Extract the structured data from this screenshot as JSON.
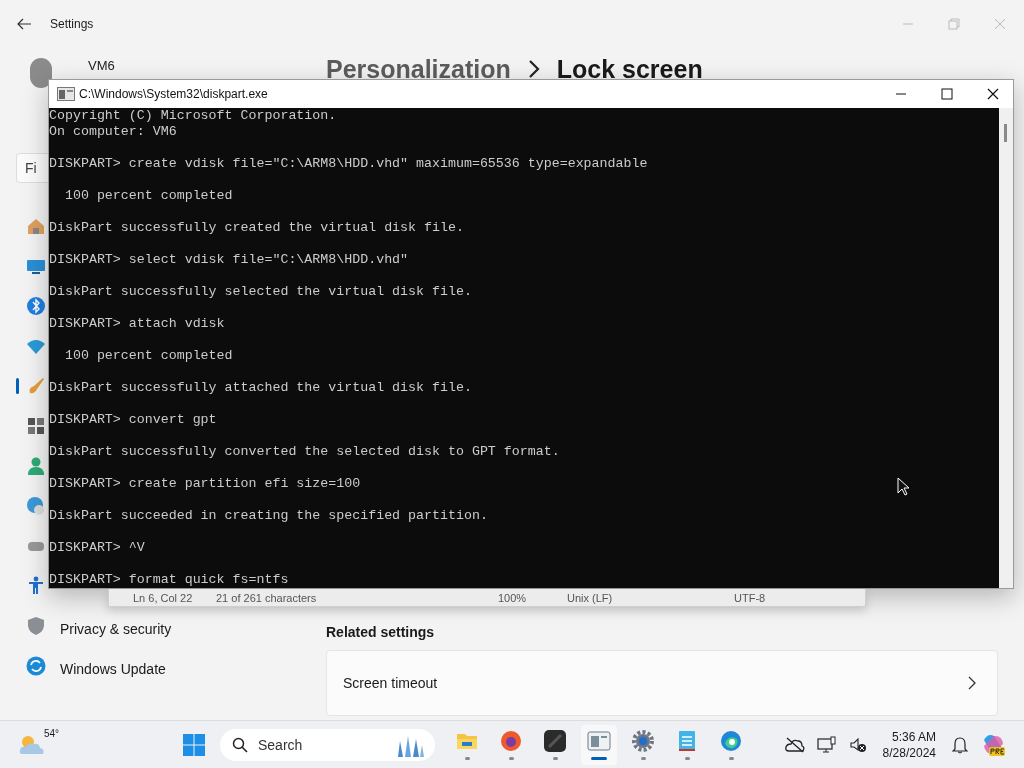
{
  "settings_window": {
    "title": "Settings",
    "profile": {
      "name": "VM6"
    },
    "search": {
      "placeholder": "Fi"
    },
    "sidebar": {
      "items": [
        {
          "selected": false
        },
        {
          "selected": false
        },
        {
          "selected": false
        },
        {
          "selected": false
        },
        {
          "selected": true
        },
        {
          "selected": false
        },
        {
          "selected": false
        },
        {
          "selected": false
        },
        {
          "selected": false
        },
        {
          "selected": false
        },
        {
          "label": "Privacy & security",
          "selected": false
        },
        {
          "label": "Windows Update",
          "selected": false
        }
      ]
    },
    "breadcrumb": [
      "Personalization",
      "Lock screen"
    ],
    "related_settings": {
      "heading": "Related settings",
      "items": [
        {
          "label": "Screen timeout"
        }
      ]
    }
  },
  "console_window": {
    "title": "C:\\Windows\\System32\\diskpart.exe",
    "blocks": [
      [
        "Copyright (C) Microsoft Corporation.",
        "On computer: VM6"
      ],
      [
        "DISKPART> create vdisk file=\"C:\\ARM8\\HDD.vhd\" maximum=65536 type=expandable"
      ],
      [
        "  100 percent completed"
      ],
      [
        "DiskPart successfully created the virtual disk file."
      ],
      [
        "DISKPART> select vdisk file=\"C:\\ARM8\\HDD.vhd\""
      ],
      [
        "DiskPart successfully selected the virtual disk file."
      ],
      [
        "DISKPART> attach vdisk"
      ],
      [
        "  100 percent completed"
      ],
      [
        "DiskPart successfully attached the virtual disk file."
      ],
      [
        "DISKPART> convert gpt"
      ],
      [
        "DiskPart successfully converted the selected disk to GPT format."
      ],
      [
        "DISKPART> create partition efi size=100"
      ],
      [
        "DiskPart succeeded in creating the specified partition."
      ],
      [
        "DISKPART> ^V"
      ],
      [
        "DISKPART> format quick fs=ntfs"
      ]
    ]
  },
  "notepad_status_bar": [
    "Ln 6, Col 22",
    "21 of 261 characters",
    "100%",
    "Unix (LF)",
    "UTF-8"
  ],
  "taskbar": {
    "weather": {
      "temperature": "54°"
    },
    "search": {
      "placeholder": "Search"
    },
    "apps": [
      {
        "selected": false
      },
      {
        "selected": false
      },
      {
        "selected": false
      },
      {
        "selected": true
      },
      {
        "selected": false
      },
      {
        "selected": false
      },
      {
        "selected": false
      }
    ],
    "clock": {
      "time": "5:36 AM",
      "date": "8/28/2024"
    }
  }
}
